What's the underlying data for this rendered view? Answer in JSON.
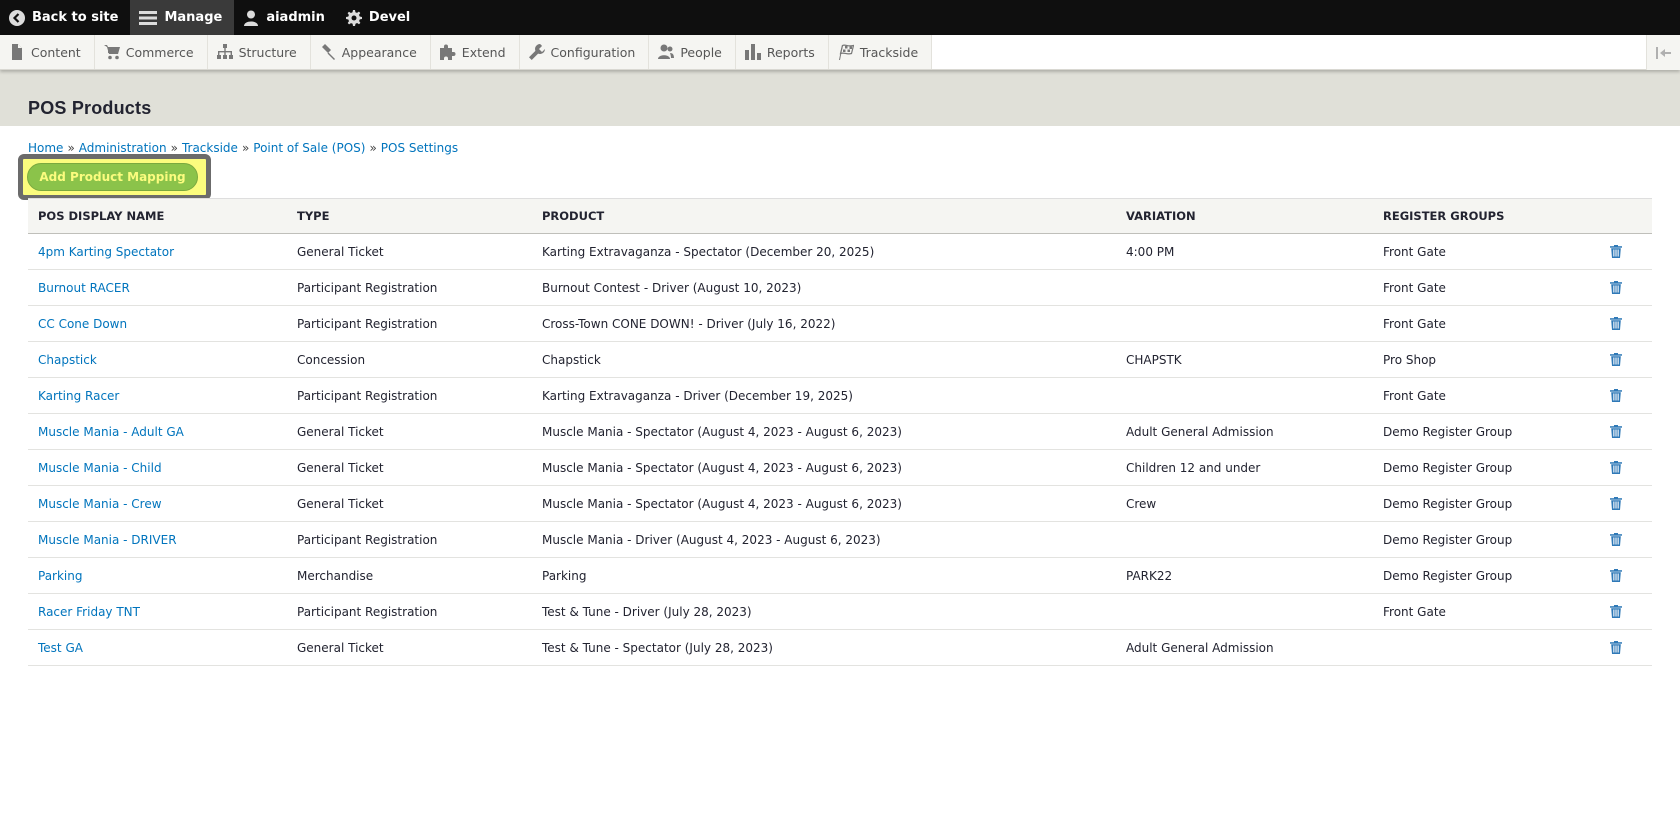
{
  "toolbar": {
    "back_label": "Back to site",
    "manage_label": "Manage",
    "user_label": "aiadmin",
    "devel_label": "Devel"
  },
  "tray": {
    "items": [
      {
        "label": "Content",
        "icon": "file-icon"
      },
      {
        "label": "Commerce",
        "icon": "cart-icon"
      },
      {
        "label": "Structure",
        "icon": "sitemap-icon"
      },
      {
        "label": "Appearance",
        "icon": "paintbrush-icon"
      },
      {
        "label": "Extend",
        "icon": "puzzle-icon"
      },
      {
        "label": "Configuration",
        "icon": "wrench-icon"
      },
      {
        "label": "People",
        "icon": "people-icon"
      },
      {
        "label": "Reports",
        "icon": "bar-chart-icon"
      },
      {
        "label": "Trackside",
        "icon": "checkered-flag-icon"
      }
    ]
  },
  "page": {
    "title": "POS Products"
  },
  "breadcrumb": [
    "Home",
    "Administration",
    "Trackside",
    "Point of Sale (POS)",
    "POS Settings"
  ],
  "breadcrumb_separator": "»",
  "actions": {
    "add_label": "Add Product Mapping"
  },
  "table": {
    "headers": [
      "POS DISPLAY NAME",
      "TYPE",
      "PRODUCT",
      "VARIATION",
      "REGISTER GROUPS"
    ],
    "rows": [
      [
        "4pm Karting Spectator",
        "General Ticket",
        "Karting Extravaganza - Spectator (December 20, 2025)",
        "4:00 PM",
        "Front Gate"
      ],
      [
        "Burnout RACER",
        "Participant Registration",
        "Burnout Contest - Driver (August 10, 2023)",
        "",
        "Front Gate"
      ],
      [
        "CC Cone Down",
        "Participant Registration",
        "Cross-Town CONE DOWN! - Driver (July 16, 2022)",
        "",
        "Front Gate"
      ],
      [
        "Chapstick",
        "Concession",
        "Chapstick",
        "CHAPSTK",
        "Pro Shop"
      ],
      [
        "Karting Racer",
        "Participant Registration",
        "Karting Extravaganza - Driver (December 19, 2025)",
        "",
        "Front Gate"
      ],
      [
        "Muscle Mania - Adult GA",
        "General Ticket",
        "Muscle Mania - Spectator (August 4, 2023 - August 6, 2023)",
        "Adult General Admission",
        "Demo Register Group"
      ],
      [
        "Muscle Mania - Child",
        "General Ticket",
        "Muscle Mania - Spectator (August 4, 2023 - August 6, 2023)",
        "Children 12 and under",
        "Demo Register Group"
      ],
      [
        "Muscle Mania - Crew",
        "General Ticket",
        "Muscle Mania - Spectator (August 4, 2023 - August 6, 2023)",
        "Crew",
        "Demo Register Group"
      ],
      [
        "Muscle Mania - DRIVER",
        "Participant Registration",
        "Muscle Mania - Driver (August 4, 2023 - August 6, 2023)",
        "",
        "Demo Register Group"
      ],
      [
        "Parking",
        "Merchandise",
        "Parking",
        "PARK22",
        "Demo Register Group"
      ],
      [
        "Racer Friday TNT",
        "Participant Registration",
        "Test & Tune - Driver (July 28, 2023)",
        "",
        "Front Gate"
      ],
      [
        "Test GA",
        "General Ticket",
        "Test & Tune - Spectator (July 28, 2023)",
        "Adult General Admission",
        ""
      ]
    ]
  },
  "colors": {
    "link": "#0074bd",
    "button_bg": "#8bc34a",
    "button_text": "#fbfc7e",
    "toolbar_bg": "#0f0f0f",
    "header_bg": "#e0e0d8"
  }
}
